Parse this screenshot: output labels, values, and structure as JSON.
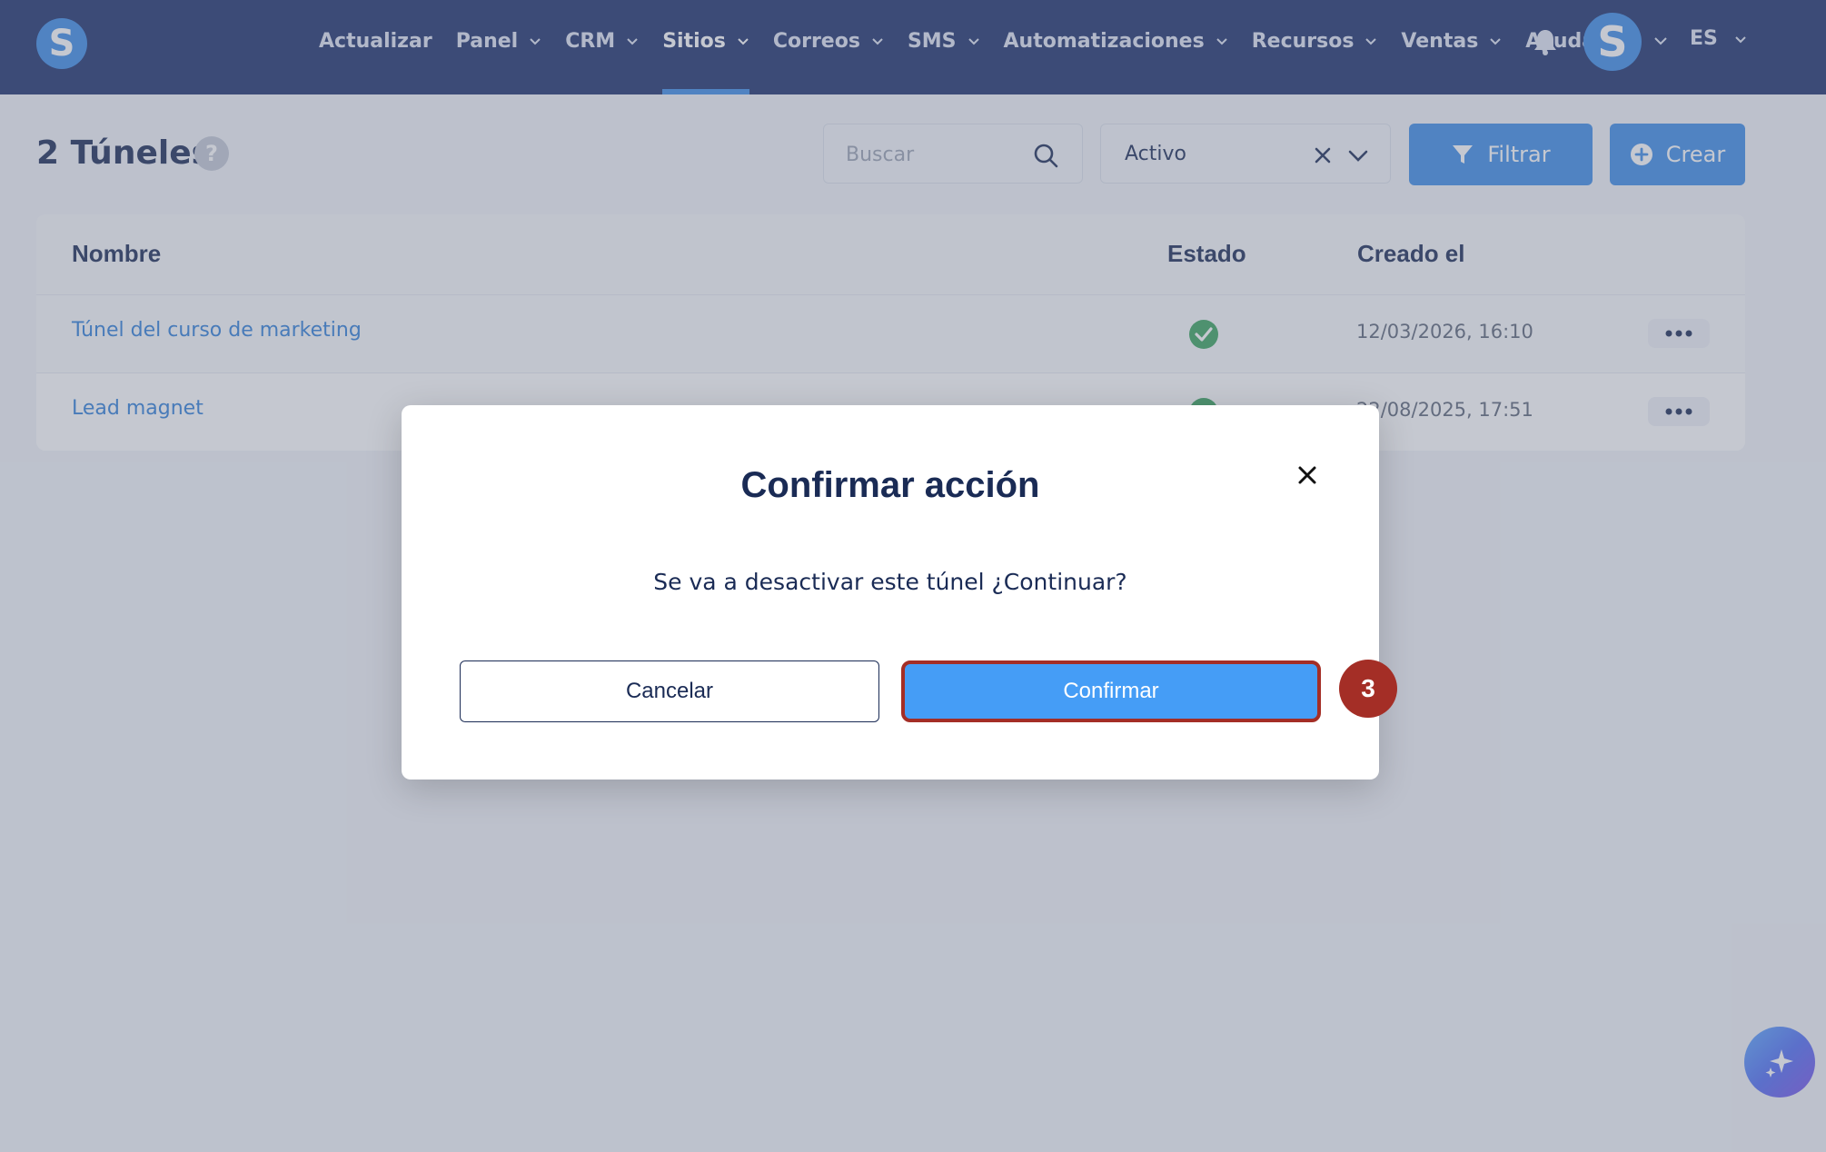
{
  "colors": {
    "nav_bg": "#1b2f6b",
    "accent": "#3d8de8",
    "confirm_button": "#459df6",
    "highlight": "#a42e26",
    "success": "#3aa35e"
  },
  "navbar": {
    "logo_letter": "S",
    "items": [
      {
        "label": "Actualizar",
        "has_dropdown": false
      },
      {
        "label": "Panel",
        "has_dropdown": true
      },
      {
        "label": "CRM",
        "has_dropdown": true
      },
      {
        "label": "Sitios",
        "has_dropdown": true,
        "active": true
      },
      {
        "label": "Correos",
        "has_dropdown": true
      },
      {
        "label": "SMS",
        "has_dropdown": true
      },
      {
        "label": "Automatizaciones",
        "has_dropdown": true
      },
      {
        "label": "Recursos",
        "has_dropdown": true
      },
      {
        "label": "Ventas",
        "has_dropdown": true
      },
      {
        "label": "Ayuda",
        "has_dropdown": false
      }
    ],
    "bell_icon": "bell-icon",
    "avatar_letter": "S",
    "language": "ES"
  },
  "toolbar": {
    "title": "2 Túneles",
    "help_label": "?",
    "search_placeholder": "Buscar",
    "status_filter_value": "Activo",
    "filter_button_label": "Filtrar",
    "create_button_label": "Crear"
  },
  "table": {
    "headers": {
      "name": "Nombre",
      "status": "Estado",
      "created": "Creado el"
    },
    "rows": [
      {
        "name": "Túnel del curso de marketing",
        "status": "active",
        "created": "12/03/2026, 16:10"
      },
      {
        "name": "Lead magnet",
        "status": "active",
        "created": "22/08/2025, 17:51"
      }
    ]
  },
  "modal": {
    "title": "Confirmar acción",
    "message": "Se va a desactivar este túnel ¿Continuar?",
    "cancel_label": "Cancelar",
    "confirm_label": "Confirmar",
    "step_number": "3"
  }
}
